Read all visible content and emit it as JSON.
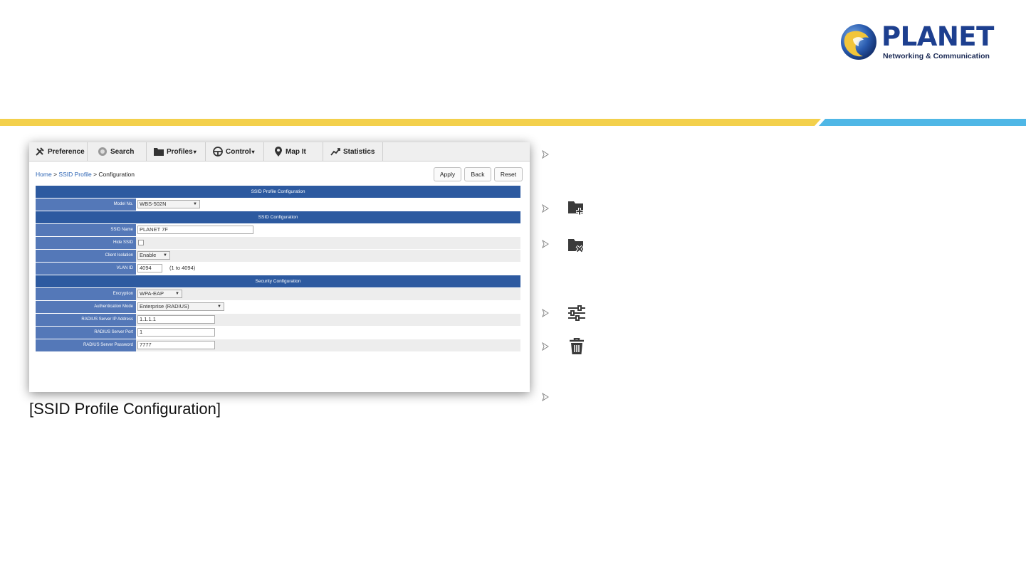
{
  "brand": {
    "name": "PLANET",
    "tagline": "Networking & Communication",
    "colors": {
      "navy": "#1d3f8f",
      "stripe_yellow": "#f3d04c",
      "stripe_blue": "#4fb7e6",
      "table_header": "#2d5aa0",
      "table_label": "#5478b8"
    }
  },
  "nav": {
    "items": [
      {
        "label": "Preference",
        "icon": "tools-icon"
      },
      {
        "label": "Search",
        "icon": "search-icon"
      },
      {
        "label": "Profiles",
        "icon": "folder-icon",
        "dropdown": true
      },
      {
        "label": "Control",
        "icon": "steering-icon",
        "dropdown": true
      },
      {
        "label": "Map It",
        "icon": "map-pin-icon"
      },
      {
        "label": "Statistics",
        "icon": "chart-icon"
      }
    ],
    "caret": "▾"
  },
  "breadcrumb": {
    "home": "Home",
    "sep": ">",
    "ssid_profile": "SSID Profile",
    "current": "Configuration"
  },
  "buttons": {
    "apply": "Apply",
    "back": "Back",
    "reset": "Reset"
  },
  "form": {
    "section_profile": "SSID Profile Configuration",
    "model_label": "Model No.",
    "model_value": "WBS-502N",
    "section_ssid": "SSID Configuration",
    "ssid_label": "SSID Name",
    "ssid_value": "PLANET 7F",
    "hide_label": "Hide SSID",
    "isolation_label": "Client Isolation",
    "isolation_value": "Enable",
    "vlan_label": "VLAN ID",
    "vlan_value": "4094",
    "vlan_hint": "(1 to 4094)",
    "section_security": "Security Configuration",
    "encryption_label": "Encryption",
    "encryption_value": "WPA-EAP",
    "auth_label": "Authentication Mode",
    "auth_value": "Enterprise (RADIUS)",
    "radius_ip_label": "RADIUS Server IP Address",
    "radius_ip_value": "1.1.1.1",
    "radius_port_label": "RADIUS Server Port",
    "radius_port_value": "1",
    "radius_pw_label": "RADIUS Server Password",
    "radius_pw_value": "7777",
    "select_arrow": "▼"
  },
  "caption": "[SSID Profile Configuration]",
  "right_icons": [
    "folder-add-icon",
    "folder-remove-icon",
    "sliders-icon",
    "trash-icon"
  ]
}
